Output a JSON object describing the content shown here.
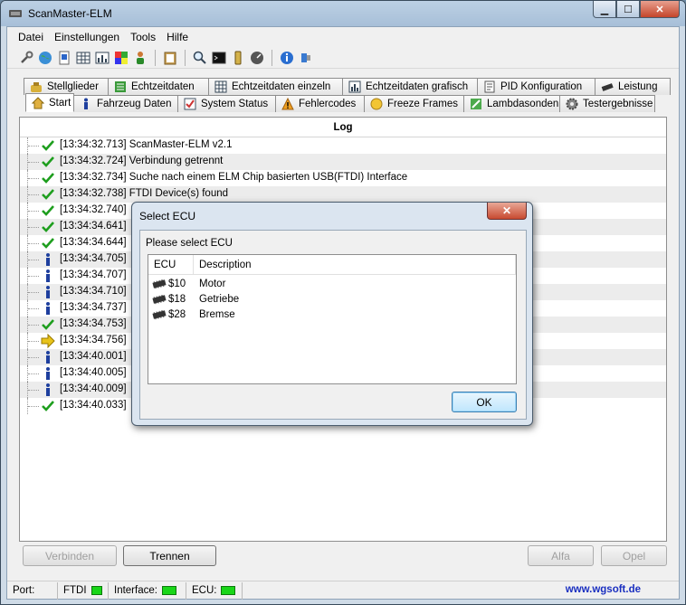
{
  "app": {
    "title": "ScanMaster-ELM"
  },
  "window_controls": {
    "minimize": "▁",
    "maximize": "☐",
    "close": "✕"
  },
  "menu": [
    "Datei",
    "Einstellungen",
    "Tools",
    "Hilfe"
  ],
  "toolbar_icons": [
    "wrench-icon",
    "globe-icon",
    "document-icon",
    "table-icon",
    "chart-icon",
    "palette-icon",
    "person-icon",
    "clipboard-icon",
    "search-icon",
    "terminal-icon",
    "battery-icon",
    "gauge-icon",
    "info-icon",
    "connector-icon"
  ],
  "tabs_top": [
    {
      "label": "Stellglieder",
      "icon": "stellglieder-icon"
    },
    {
      "label": "Echtzeitdaten",
      "icon": "list-icon"
    },
    {
      "label": "Echtzeitdaten einzeln",
      "icon": "grid-icon"
    },
    {
      "label": "Echtzeitdaten grafisch",
      "icon": "bar-chart-icon"
    },
    {
      "label": "PID Konfiguration",
      "icon": "pid-document-icon"
    },
    {
      "label": "Leistung",
      "icon": "chip-icon"
    }
  ],
  "tabs_bottom": [
    {
      "label": "Start",
      "icon": "home-icon"
    },
    {
      "label": "Fahrzeug Daten",
      "icon": "info-icon"
    },
    {
      "label": "System Status",
      "icon": "checkbox-icon"
    },
    {
      "label": "Fehlercodes",
      "icon": "warning-icon"
    },
    {
      "label": "Freeze Frames",
      "icon": "snowflake-icon"
    },
    {
      "label": "Lambdasonden",
      "icon": "sensor-icon"
    },
    {
      "label": "Testergebnisse",
      "icon": "gear-icon"
    }
  ],
  "log": {
    "header": "Log",
    "rows": [
      {
        "icon": "check",
        "text": "[13:34:32.713] ScanMaster-ELM v2.1"
      },
      {
        "icon": "check",
        "text": "[13:34:32.724] Verbindung getrennt"
      },
      {
        "icon": "check",
        "text": "[13:34:32.734] Suche nach einem ELM Chip basierten USB(FTDI) Interface"
      },
      {
        "icon": "check",
        "text": "[13:34:32.738] FTDI Device(s) found"
      },
      {
        "icon": "check",
        "text": "[13:34:32.740]"
      },
      {
        "icon": "check",
        "text": "[13:34:34.641]"
      },
      {
        "icon": "check",
        "text": "[13:34:34.644]"
      },
      {
        "icon": "info",
        "text": "[13:34:34.705]"
      },
      {
        "icon": "info",
        "text": "[13:34:34.707]"
      },
      {
        "icon": "info",
        "text": "[13:34:34.710]"
      },
      {
        "icon": "info",
        "text": "[13:34:34.737]"
      },
      {
        "icon": "check",
        "text": "[13:34:34.753]"
      },
      {
        "icon": "arrow",
        "text": "[13:34:34.756]"
      },
      {
        "icon": "info",
        "text": "[13:34:40.001]"
      },
      {
        "icon": "info",
        "text": "[13:34:40.005]"
      },
      {
        "icon": "info",
        "text": "[13:34:40.009]"
      },
      {
        "icon": "check",
        "text": "[13:34:40.033]"
      }
    ]
  },
  "buttons": {
    "verbinden": "Verbinden",
    "trennen": "Trennen",
    "alfa": "Alfa",
    "opel": "Opel"
  },
  "status": {
    "port_label": "Port:",
    "port_value": "FTDI",
    "interface_label": "Interface:",
    "ecu_label": "ECU:",
    "link": "www.wgsoft.de"
  },
  "dialog": {
    "title": "Select ECU",
    "prompt": "Please select ECU",
    "columns": [
      "ECU",
      "Description"
    ],
    "rows": [
      {
        "ecu": "$10",
        "description": "Motor"
      },
      {
        "ecu": "$18",
        "description": "Getriebe"
      },
      {
        "ecu": "$28",
        "description": "Bremse"
      }
    ],
    "ok_label": "OK"
  },
  "colors": {
    "led_on": "#19d619",
    "link": "#1a2fc0",
    "check": "#1e9e1e",
    "info": "#1e3f9e",
    "arrow": "#e8c31a"
  }
}
